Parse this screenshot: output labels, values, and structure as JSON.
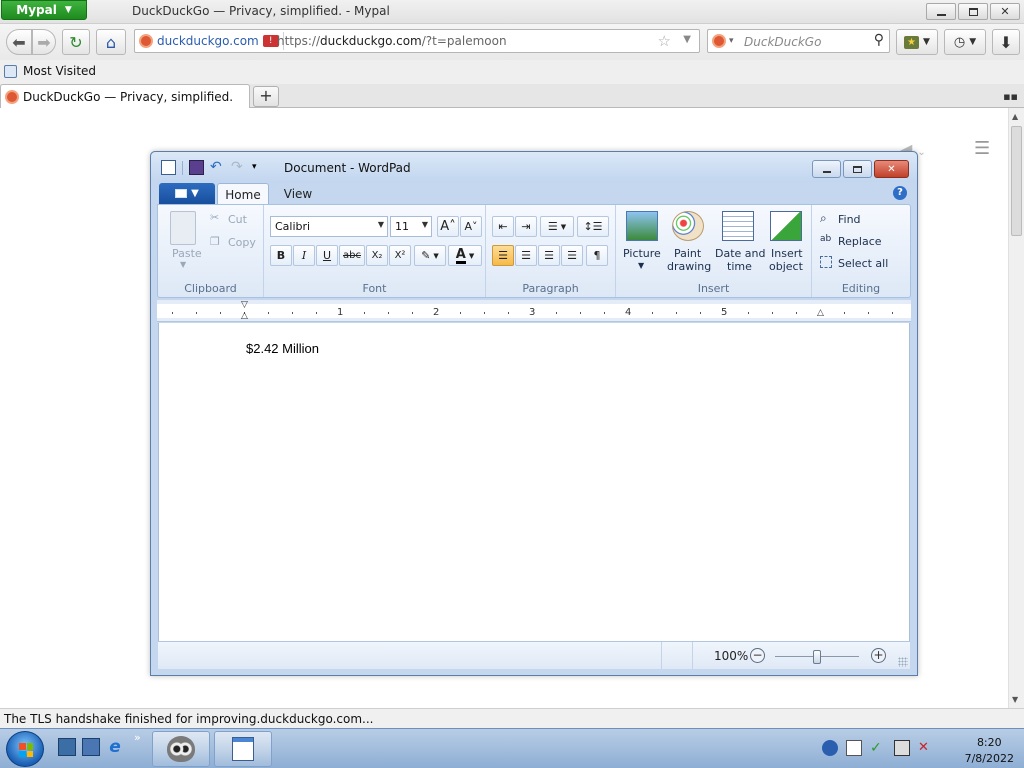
{
  "browser": {
    "app_menu_label": "Mypal",
    "window_title": "DuckDuckGo — Privacy, simplified. - Mypal",
    "identity_domain": "duckduckgo.com",
    "url_prefix": "https://",
    "url_host": "duckduckgo.com",
    "url_path": "/?t=palemoon",
    "search_placeholder": "DuckDuckGo",
    "bookmark_label": "Most Visited",
    "tab_title": "DuckDuckGo — Privacy, simplified.",
    "status_text": "The TLS handshake finished for improving.duckduckgo.com...",
    "accent_color": "#2a9d2a"
  },
  "wordpad": {
    "title": "Document - WordPad",
    "tabs": [
      "Home",
      "View"
    ],
    "clipboard": {
      "paste": "Paste",
      "cut": "Cut",
      "copy": "Copy",
      "group": "Clipboard"
    },
    "font": {
      "family": "Calibri",
      "size": "11",
      "group": "Font"
    },
    "paragraph": {
      "group": "Paragraph"
    },
    "insert": {
      "picture": "Picture",
      "paint_1": "Paint",
      "paint_2": "drawing",
      "date_1": "Date and",
      "date_2": "time",
      "object_1": "Insert",
      "object_2": "object",
      "group": "Insert"
    },
    "editing": {
      "find": "Find",
      "replace": "Replace",
      "select_all": "Select all",
      "group": "Editing"
    },
    "ruler_numbers": [
      "1",
      "2",
      "3",
      "4",
      "5"
    ],
    "document_text": "$2.42 Million",
    "zoom": "100%",
    "zoom_level_percent": 100
  },
  "taskbar": {
    "time": "8:20",
    "date": "7/8/2022"
  }
}
